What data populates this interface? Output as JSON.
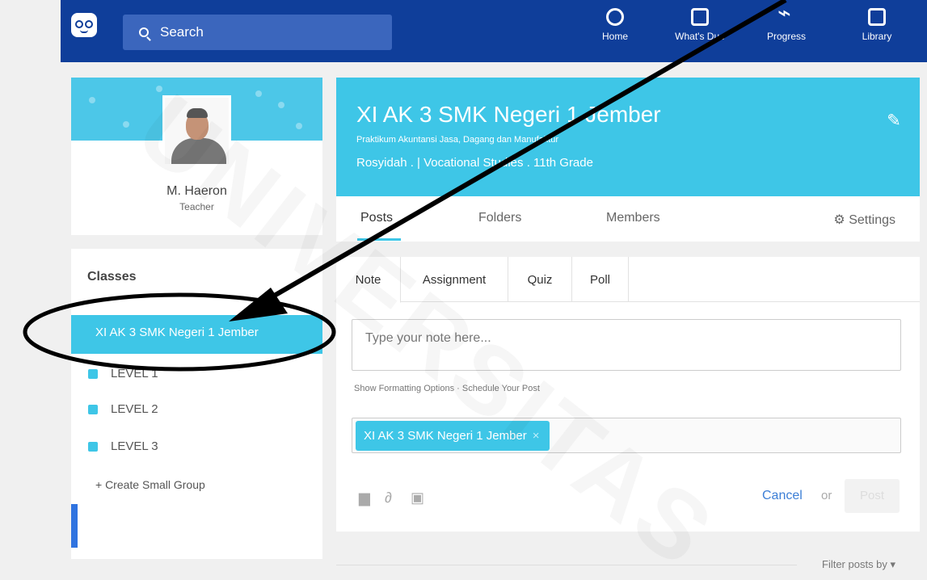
{
  "topbar": {
    "search_placeholder": "Search",
    "nav": [
      {
        "label": "Home",
        "icon": "home-icon"
      },
      {
        "label": "What's Due",
        "icon": "calendar-check-icon"
      },
      {
        "label": "Progress",
        "icon": "progress-pulse-icon"
      },
      {
        "label": "Library",
        "icon": "library-icon"
      }
    ]
  },
  "profile": {
    "name": "M. Haeron",
    "role": "Teacher"
  },
  "class_header": {
    "title": "XI AK 3 SMK Negeri 1 Jember",
    "subtitle": "Praktikum Akuntansi Jasa, Dagang dan Manufaktur",
    "meta": "Rosyidah . | Vocational Studies . 11th Grade"
  },
  "class_tabs": {
    "posts": "Posts",
    "folders": "Folders",
    "members": "Members",
    "settings": "Settings"
  },
  "classes_panel": {
    "heading": "Classes",
    "selected_class": "XI AK 3 SMK Negeri 1 Jember",
    "groups": [
      "LEVEL 1",
      "LEVEL 2",
      "LEVEL 3"
    ],
    "create_label": "+ Create Small Group"
  },
  "composer": {
    "tabs": [
      "Note",
      "Assignment",
      "Quiz",
      "Poll"
    ],
    "note_placeholder": "Type your note here...",
    "links": "Show Formatting Options · Schedule Your Post",
    "recipient_chip": "XI AK 3 SMK Negeri 1 Jember",
    "chip_close": "×",
    "cancel": "Cancel",
    "or": "or",
    "post": "Post"
  },
  "feed": {
    "filter": "Filter posts by ▾"
  },
  "colors": {
    "nav_blue": "#0f3e9a",
    "accent_cyan": "#3ec6e7",
    "link_blue": "#3d7fd6"
  }
}
